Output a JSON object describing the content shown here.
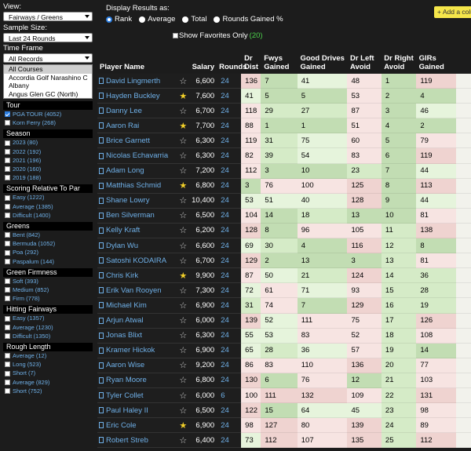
{
  "sidebar": {
    "view_label": "View:",
    "view_value": "Fairways / Greens",
    "sample_label": "Sample Size:",
    "sample_value": "Last 24 Rounds",
    "timeframe_label": "Time Frame",
    "timeframe_value": "All Records",
    "courses": [
      "All Courses",
      "Accordia Golf Narashino C",
      "Albany",
      "Angus Glen GC (North)"
    ],
    "sections": [
      {
        "title": "Tour",
        "items": [
          {
            "label": "PGA TOUR (4052)",
            "checked": true
          },
          {
            "label": "Korn Ferry (268)",
            "checked": false
          }
        ]
      },
      {
        "title": "Season",
        "items": [
          {
            "label": "2023 (80)",
            "checked": false
          },
          {
            "label": "2022 (192)",
            "checked": false
          },
          {
            "label": "2021 (196)",
            "checked": false
          },
          {
            "label": "2020 (160)",
            "checked": false
          },
          {
            "label": "2019 (188)",
            "checked": false
          }
        ]
      },
      {
        "title": "Scoring Relative To Par",
        "items": [
          {
            "label": "Easy (1222)",
            "checked": false
          },
          {
            "label": "Average (1385)",
            "checked": false
          },
          {
            "label": "Difficult (1400)",
            "checked": false
          }
        ]
      },
      {
        "title": "Greens",
        "items": [
          {
            "label": "Bent (842)",
            "checked": false
          },
          {
            "label": "Bermuda (1052)",
            "checked": false
          },
          {
            "label": "Poa (292)",
            "checked": false
          },
          {
            "label": "Paspalum (144)",
            "checked": false
          }
        ]
      },
      {
        "title": "Green Firmness",
        "items": [
          {
            "label": "Soft (393)",
            "checked": false
          },
          {
            "label": "Medium (852)",
            "checked": false
          },
          {
            "label": "Firm (778)",
            "checked": false
          }
        ]
      },
      {
        "title": "Hitting Fairways",
        "items": [
          {
            "label": "Easy (1357)",
            "checked": false
          },
          {
            "label": "Average (1230)",
            "checked": false
          },
          {
            "label": "Difficult (1350)",
            "checked": false
          }
        ]
      },
      {
        "title": "Rough Length",
        "items": [
          {
            "label": "Average (12)",
            "checked": false
          },
          {
            "label": "Long (523)",
            "checked": false
          },
          {
            "label": "Short (7)",
            "checked": false
          },
          {
            "label": "Average (829)",
            "checked": false
          },
          {
            "label": "Short (752)",
            "checked": false
          }
        ]
      }
    ]
  },
  "display": {
    "label": "Display Results as:",
    "options": [
      {
        "label": "Rank",
        "checked": true
      },
      {
        "label": "Average",
        "checked": false
      },
      {
        "label": "Total",
        "checked": false
      },
      {
        "label": "Rounds Gained %",
        "checked": false
      }
    ],
    "favorites_label": "Show Favorites Only",
    "favorites_count": "(20)",
    "add_column_label": "+ Add a column"
  },
  "table": {
    "headers": [
      "Player Name",
      "Salary",
      "Rounds",
      "Dr Dist",
      "Fwys Gained",
      "Good Drives Gained",
      "Dr Left Avoid",
      "Dr Right Avoid",
      "GIRs Gained",
      ""
    ],
    "rows": [
      {
        "name": "David Lingmerth",
        "fav": false,
        "salary": "6,600",
        "rounds": "24",
        "v": [
          "136",
          "7",
          "41",
          "48",
          "1",
          "119",
          ""
        ],
        "bg": [
          "r2",
          "g3",
          "g1",
          "r1",
          "g3",
          "r2",
          "n"
        ]
      },
      {
        "name": "Hayden Buckley",
        "fav": true,
        "salary": "7,600",
        "rounds": "24",
        "v": [
          "41",
          "5",
          "5",
          "53",
          "2",
          "4",
          ""
        ],
        "bg": [
          "g1",
          "g3",
          "g3",
          "r1",
          "g3",
          "g3",
          "n"
        ]
      },
      {
        "name": "Danny Lee",
        "fav": false,
        "salary": "6,700",
        "rounds": "24",
        "v": [
          "118",
          "29",
          "27",
          "87",
          "3",
          "46",
          ""
        ],
        "bg": [
          "r1",
          "g2",
          "g2",
          "r1",
          "g3",
          "g1",
          "n"
        ]
      },
      {
        "name": "Aaron Rai",
        "fav": true,
        "salary": "7,700",
        "rounds": "24",
        "v": [
          "88",
          "1",
          "1",
          "51",
          "4",
          "2",
          ""
        ],
        "bg": [
          "r1",
          "g3",
          "g3",
          "r1",
          "g3",
          "g3",
          "n"
        ]
      },
      {
        "name": "Brice Garnett",
        "fav": false,
        "salary": "6,300",
        "rounds": "24",
        "v": [
          "119",
          "31",
          "75",
          "60",
          "5",
          "79",
          ""
        ],
        "bg": [
          "r1",
          "g2",
          "g1",
          "r1",
          "g3",
          "r1",
          "n"
        ]
      },
      {
        "name": "Nicolas Echavarria",
        "fav": false,
        "salary": "6,300",
        "rounds": "24",
        "v": [
          "82",
          "39",
          "54",
          "83",
          "6",
          "119",
          ""
        ],
        "bg": [
          "r1",
          "g2",
          "g1",
          "r1",
          "g3",
          "r2",
          "n"
        ]
      },
      {
        "name": "Adam Long",
        "fav": false,
        "salary": "7,200",
        "rounds": "24",
        "v": [
          "112",
          "3",
          "10",
          "23",
          "7",
          "44",
          ""
        ],
        "bg": [
          "r1",
          "g3",
          "g3",
          "g2",
          "g3",
          "g1",
          "n"
        ]
      },
      {
        "name": "Matthias Schmid",
        "fav": true,
        "salary": "6,800",
        "rounds": "24",
        "v": [
          "3",
          "76",
          "100",
          "125",
          "8",
          "113",
          ""
        ],
        "bg": [
          "g3",
          "r1",
          "r1",
          "r2",
          "g3",
          "r2",
          "n"
        ]
      },
      {
        "name": "Shane Lowry",
        "fav": false,
        "salary": "10,400",
        "rounds": "24",
        "v": [
          "53",
          "51",
          "40",
          "128",
          "9",
          "44",
          ""
        ],
        "bg": [
          "g1",
          "g1",
          "g1",
          "r2",
          "g3",
          "g1",
          "n"
        ]
      },
      {
        "name": "Ben Silverman",
        "fav": false,
        "salary": "6,500",
        "rounds": "24",
        "v": [
          "104",
          "14",
          "18",
          "13",
          "10",
          "81",
          ""
        ],
        "bg": [
          "r1",
          "g3",
          "g2",
          "g3",
          "g3",
          "r1",
          "n"
        ]
      },
      {
        "name": "Kelly Kraft",
        "fav": false,
        "salary": "6,200",
        "rounds": "24",
        "v": [
          "128",
          "8",
          "96",
          "105",
          "11",
          "138",
          ""
        ],
        "bg": [
          "r2",
          "g3",
          "r1",
          "r1",
          "g2",
          "r2",
          "n"
        ]
      },
      {
        "name": "Dylan Wu",
        "fav": false,
        "salary": "6,600",
        "rounds": "24",
        "v": [
          "69",
          "30",
          "4",
          "116",
          "12",
          "8",
          ""
        ],
        "bg": [
          "g1",
          "g2",
          "g3",
          "r2",
          "g2",
          "g3",
          "n"
        ]
      },
      {
        "name": "Satoshi KODAIRA",
        "fav": false,
        "salary": "6,700",
        "rounds": "24",
        "v": [
          "129",
          "2",
          "13",
          "3",
          "13",
          "81",
          ""
        ],
        "bg": [
          "r2",
          "g3",
          "g3",
          "g3",
          "g2",
          "r1",
          "n"
        ]
      },
      {
        "name": "Chris Kirk",
        "fav": true,
        "salary": "9,900",
        "rounds": "24",
        "v": [
          "87",
          "50",
          "21",
          "124",
          "14",
          "36",
          ""
        ],
        "bg": [
          "r1",
          "g1",
          "g2",
          "r2",
          "g2",
          "g2",
          "n"
        ]
      },
      {
        "name": "Erik Van Rooyen",
        "fav": false,
        "salary": "7,300",
        "rounds": "24",
        "v": [
          "72",
          "61",
          "71",
          "93",
          "15",
          "28",
          ""
        ],
        "bg": [
          "g1",
          "r1",
          "g1",
          "r1",
          "g2",
          "g2",
          "n"
        ]
      },
      {
        "name": "Michael Kim",
        "fav": false,
        "salary": "6,900",
        "rounds": "24",
        "v": [
          "31",
          "74",
          "7",
          "129",
          "16",
          "19",
          ""
        ],
        "bg": [
          "g2",
          "r1",
          "g3",
          "r2",
          "g2",
          "g2",
          "n"
        ]
      },
      {
        "name": "Arjun Atwal",
        "fav": false,
        "salary": "6,000",
        "rounds": "24",
        "v": [
          "139",
          "52",
          "111",
          "75",
          "17",
          "126",
          ""
        ],
        "bg": [
          "r2",
          "g1",
          "r1",
          "r1",
          "g2",
          "r2",
          "n"
        ]
      },
      {
        "name": "Jonas Blixt",
        "fav": false,
        "salary": "6,300",
        "rounds": "24",
        "v": [
          "55",
          "53",
          "83",
          "52",
          "18",
          "108",
          ""
        ],
        "bg": [
          "g1",
          "g1",
          "r1",
          "r1",
          "g2",
          "r1",
          "n"
        ]
      },
      {
        "name": "Kramer Hickok",
        "fav": false,
        "salary": "6,900",
        "rounds": "24",
        "v": [
          "65",
          "28",
          "36",
          "57",
          "19",
          "14",
          ""
        ],
        "bg": [
          "g1",
          "g2",
          "g1",
          "r1",
          "g2",
          "g3",
          "n"
        ]
      },
      {
        "name": "Aaron Wise",
        "fav": false,
        "salary": "9,200",
        "rounds": "24",
        "v": [
          "86",
          "83",
          "110",
          "136",
          "20",
          "77",
          ""
        ],
        "bg": [
          "r1",
          "r1",
          "r1",
          "r2",
          "g2",
          "r1",
          "n"
        ]
      },
      {
        "name": "Ryan Moore",
        "fav": false,
        "salary": "6,800",
        "rounds": "24",
        "v": [
          "130",
          "6",
          "76",
          "12",
          "21",
          "103",
          ""
        ],
        "bg": [
          "r2",
          "g3",
          "r1",
          "g3",
          "g2",
          "r1",
          "n"
        ]
      },
      {
        "name": "Tyler Collet",
        "fav": false,
        "salary": "6,000",
        "rounds": "6",
        "v": [
          "100",
          "111",
          "132",
          "109",
          "22",
          "131",
          ""
        ],
        "bg": [
          "r1",
          "r2",
          "r2",
          "r1",
          "g2",
          "r2",
          "n"
        ]
      },
      {
        "name": "Paul Haley II",
        "fav": false,
        "salary": "6,500",
        "rounds": "24",
        "v": [
          "122",
          "15",
          "64",
          "45",
          "23",
          "98",
          ""
        ],
        "bg": [
          "r2",
          "g3",
          "g1",
          "g1",
          "g2",
          "r1",
          "n"
        ]
      },
      {
        "name": "Eric Cole",
        "fav": true,
        "salary": "6,900",
        "rounds": "24",
        "v": [
          "98",
          "127",
          "80",
          "139",
          "24",
          "89",
          ""
        ],
        "bg": [
          "r1",
          "r2",
          "r1",
          "r2",
          "g2",
          "r1",
          "n"
        ]
      },
      {
        "name": "Robert Streb",
        "fav": false,
        "salary": "6,400",
        "rounds": "24",
        "v": [
          "73",
          "112",
          "107",
          "135",
          "25",
          "112",
          ""
        ],
        "bg": [
          "g1",
          "r2",
          "r1",
          "r2",
          "g2",
          "r2",
          "n"
        ]
      }
    ]
  }
}
